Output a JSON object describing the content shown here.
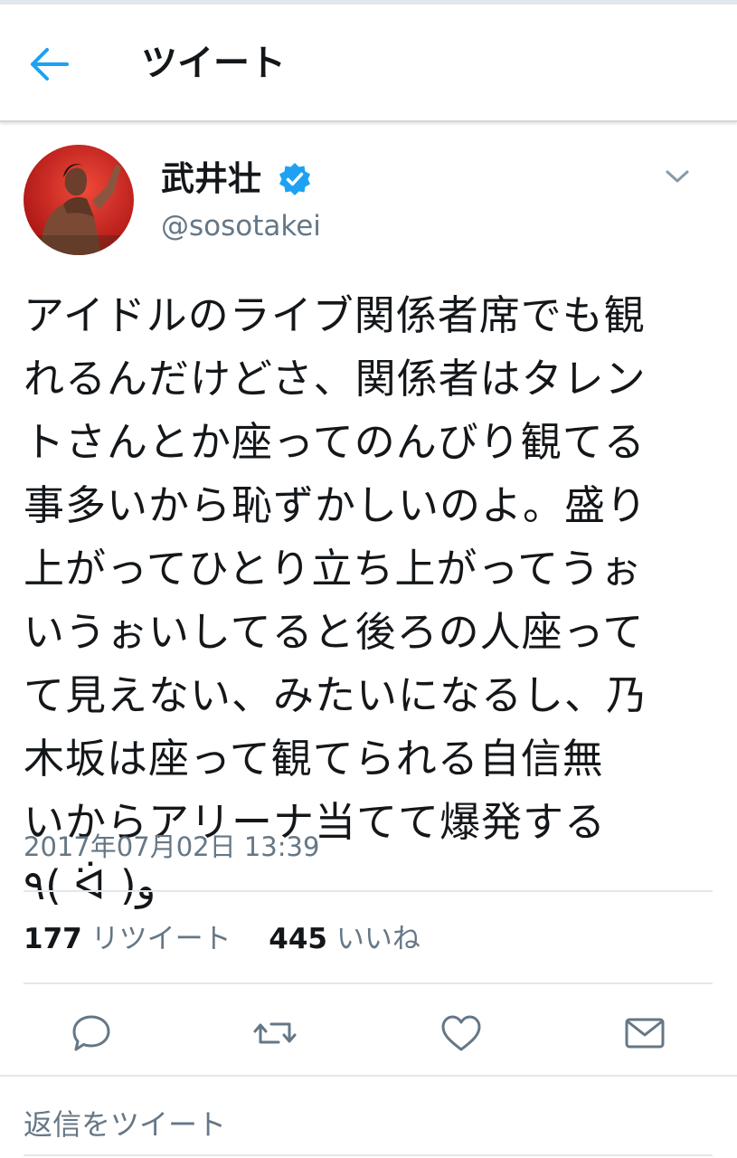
{
  "header": {
    "title": "ツイート",
    "back_icon": "back-arrow-icon"
  },
  "tweet": {
    "author_name": "武井壮",
    "author_handle": "@sosotakei",
    "verified": true,
    "text": "アイドルのライブ関係者席でも観\nれるんだけどさ、関係者はタレン\nトさんとか座ってのんびり観てる\n事多いから恥ずかしいのよ。盛り\n上がってひとり立ち上がってうぉ\nいうぉいしてると後ろの人座って\nて見えない、みたいになるし、乃\n木坂は座って観てられる自信無\nいからアリーナ当てて爆発する\n٩( ᐛ )و",
    "timestamp": "2017年07月02日 13:39"
  },
  "stats": {
    "retweets_count": "177",
    "retweets_label": "リツイート",
    "likes_count": "445",
    "likes_label": "いいね"
  },
  "actions": [
    "reply-icon",
    "retweet-icon",
    "like-icon",
    "message-icon"
  ],
  "reply": {
    "placeholder": "返信をツイート"
  },
  "colors": {
    "accent": "#1da1f2",
    "text": "#14171a",
    "muted": "#657786",
    "divider": "#e1e8ed"
  }
}
